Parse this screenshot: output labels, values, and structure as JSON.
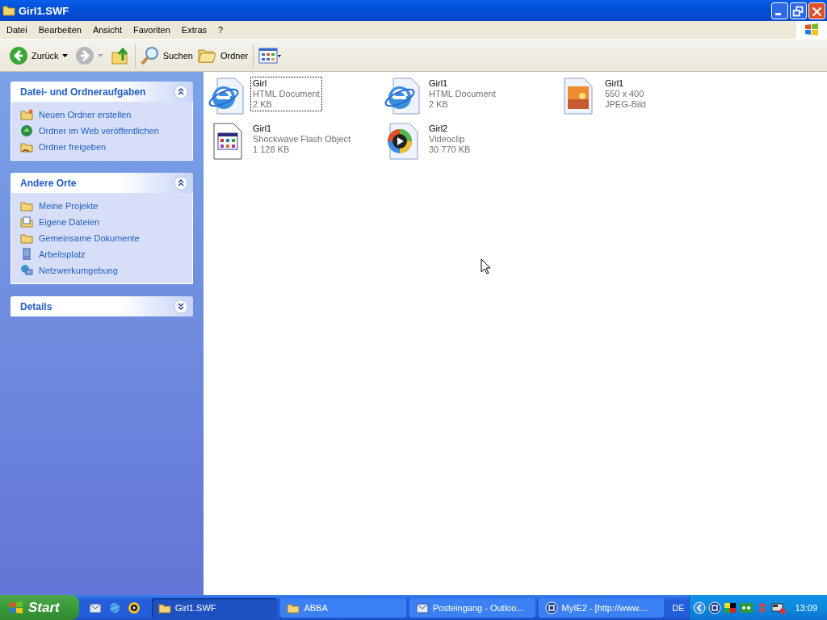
{
  "window": {
    "title": "Girl1.SWF"
  },
  "menu": [
    "Datei",
    "Bearbeiten",
    "Ansicht",
    "Favoriten",
    "Extras",
    "?"
  ],
  "toolbar": {
    "back": {
      "label": "Zurück",
      "disabled": false
    },
    "forward": {
      "disabled": true
    },
    "search": {
      "label": "Suchen"
    },
    "folders": {
      "label": "Ordner"
    }
  },
  "sidebar": [
    {
      "title": "Datei- und Ordneraufgaben",
      "expanded": true,
      "items": [
        {
          "kind": "new-folder",
          "label": "Neuen Ordner erstellen"
        },
        {
          "kind": "web",
          "label": "Ordner im Web veröffentlichen"
        },
        {
          "kind": "share",
          "label": "Ordner freigeben"
        }
      ]
    },
    {
      "title": "Andere Orte",
      "expanded": true,
      "items": [
        {
          "kind": "folder",
          "label": "Meine Projekte"
        },
        {
          "kind": "documents",
          "label": "Eigene Dateien"
        },
        {
          "kind": "folder",
          "label": "Gemeinsame Dokumente"
        },
        {
          "kind": "computer",
          "label": "Arbeitsplatz"
        },
        {
          "kind": "network",
          "label": "Netzwerkumgebung"
        }
      ]
    },
    {
      "title": "Details",
      "expanded": false
    }
  ],
  "files": [
    {
      "kind": "html",
      "name": "Girl",
      "lines": [
        "HTML Document",
        "2 KB"
      ],
      "focused": true
    },
    {
      "kind": "html",
      "name": "Girl1",
      "lines": [
        "HTML Document",
        "2 KB"
      ],
      "focused": false
    },
    {
      "kind": "jpeg",
      "name": "Girl1",
      "lines": [
        "550 x 400",
        "JPEG-Bild"
      ],
      "focused": false
    },
    {
      "kind": "flash",
      "name": "Girl1",
      "lines": [
        "Shockwave Flash Object",
        "1 128 KB"
      ],
      "focused": false
    },
    {
      "kind": "video",
      "name": "Girl2",
      "lines": [
        "Videoclip",
        "30 770 KB"
      ],
      "focused": false
    }
  ],
  "taskbar": {
    "start": "Start",
    "tasks": [
      {
        "kind": "folder",
        "label": "Girl1.SWF",
        "selected": true
      },
      {
        "kind": "folder",
        "label": "ABBA",
        "selected": false
      },
      {
        "kind": "mail",
        "label": "Posteingang - Outloo...",
        "selected": false
      },
      {
        "kind": "browser",
        "label": "MyIE2 - [http://www....",
        "selected": false
      }
    ],
    "language": "DE",
    "clock": "13:09"
  }
}
